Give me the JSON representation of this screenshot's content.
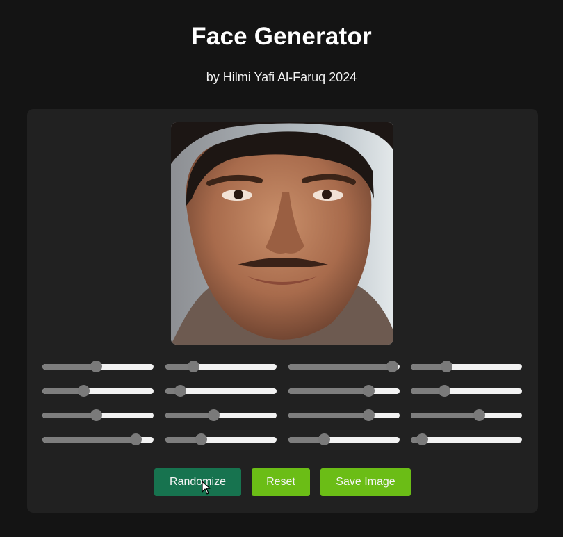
{
  "header": {
    "title": "Face Generator",
    "subtitle": "by Hilmi Yafi Al-Faruq 2024"
  },
  "image": {
    "description_icon": "generated-face"
  },
  "sliders": [
    {
      "value": 0.48
    },
    {
      "value": 0.25
    },
    {
      "value": 0.93
    },
    {
      "value": 0.32
    },
    {
      "value": 0.37
    },
    {
      "value": 0.13
    },
    {
      "value": 0.72
    },
    {
      "value": 0.3
    },
    {
      "value": 0.48
    },
    {
      "value": 0.43
    },
    {
      "value": 0.72
    },
    {
      "value": 0.61
    },
    {
      "value": 0.84
    },
    {
      "value": 0.32
    },
    {
      "value": 0.32
    },
    {
      "value": 0.1
    }
  ],
  "buttons": {
    "randomize": "Randomize",
    "reset": "Reset",
    "save": "Save Image"
  },
  "colors": {
    "background": "#141414",
    "panel": "#212121",
    "randomize": "#17734f",
    "accent_green": "#6bbd16",
    "slider_track": "#f2f2f2",
    "slider_fill": "#7e7e7e"
  }
}
